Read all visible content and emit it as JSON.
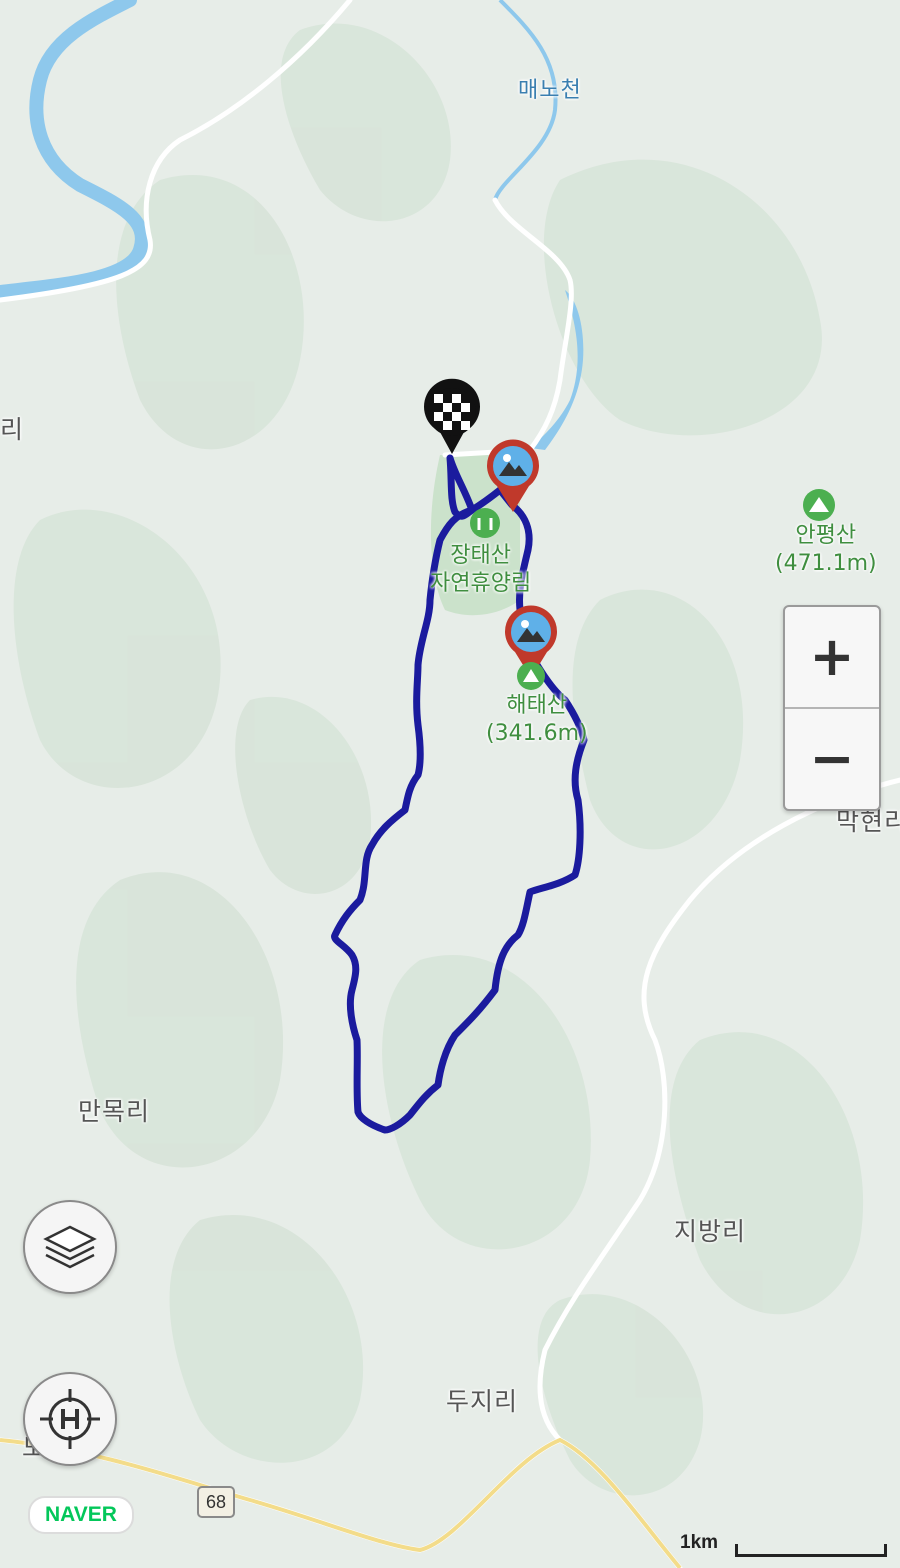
{
  "map": {
    "place_labels": {
      "maenocheon": "매노천",
      "ri_partial": "리",
      "manmok": "만목리",
      "jibang": "지방리",
      "duji": "두지리",
      "doseon": "도산리",
      "makyeon": "막현리"
    },
    "pois": {
      "jangtaesan": {
        "name": "장태산\n자연휴양림"
      },
      "anpyeongsan": {
        "name": "안평산",
        "elevation": "(471.1m)"
      },
      "haetaesan": {
        "name": "해태산",
        "elevation": "(341.6m)"
      }
    },
    "road_number": "68",
    "route_color": "#1b1b9e",
    "water_color": "#8ec8ec",
    "park_color": "#c8e0c8"
  },
  "controls": {
    "zoom_in": "+",
    "zoom_out": "−",
    "layers_icon": "layers-icon",
    "home_icon": "home-locate-icon"
  },
  "branding": {
    "logo": "NAVER"
  },
  "scale": {
    "label": "1km"
  }
}
